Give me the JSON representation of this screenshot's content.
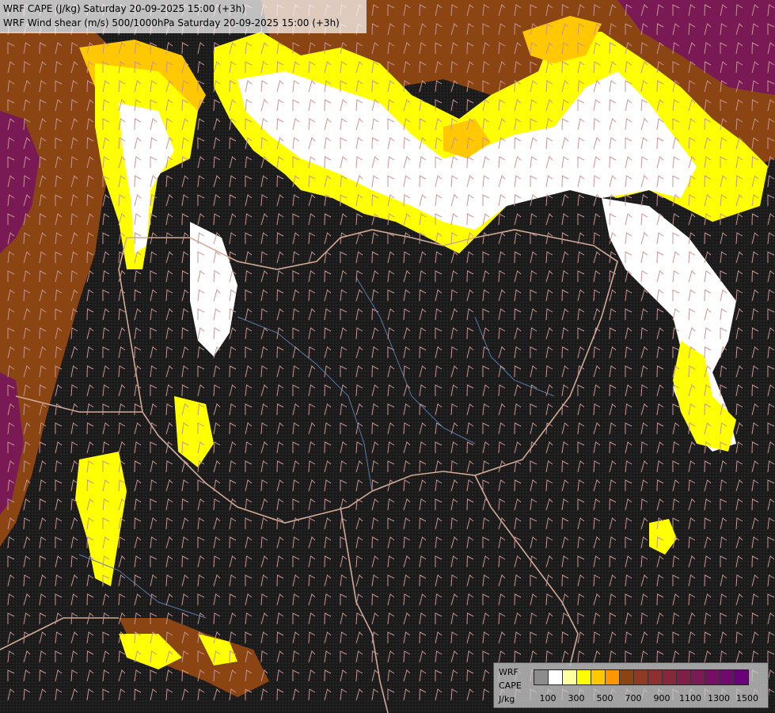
{
  "title": {
    "line1": "WRF CAPE (J/kg) Saturday 20-09-2025 15:00 (+3h)",
    "line2": "WRF Wind shear (m/s) 500/1000hPa Saturday 20-09-2025 15:00 (+3h)"
  },
  "legend": {
    "caption1": "WRF",
    "caption2": "CAPE",
    "caption3": "J/kg",
    "colors": [
      "#8c8c8c",
      "#ffffff",
      "#ffffa0",
      "#ffff00",
      "#ffc800",
      "#ff9600",
      "#8b4513",
      "#903a22",
      "#8e2f30",
      "#86273a",
      "#7e1f47",
      "#7a1a55",
      "#760f63",
      "#700a6e",
      "#690278"
    ],
    "tick_labels": [
      "100",
      "300",
      "500",
      "700",
      "900",
      "1100",
      "1300",
      "1500"
    ]
  },
  "map": {
    "cape_colors": {
      "none": "#111111",
      "low": "#ffffa0",
      "mid": "#ffff00",
      "orange": "#ffc800",
      "brown": "#8b4513",
      "maroon": "#7a1a55",
      "white": "#ffffff"
    },
    "barb_color": "#c89494",
    "border_color": "#d2aa96",
    "river_color": "#5a7aa6"
  }
}
